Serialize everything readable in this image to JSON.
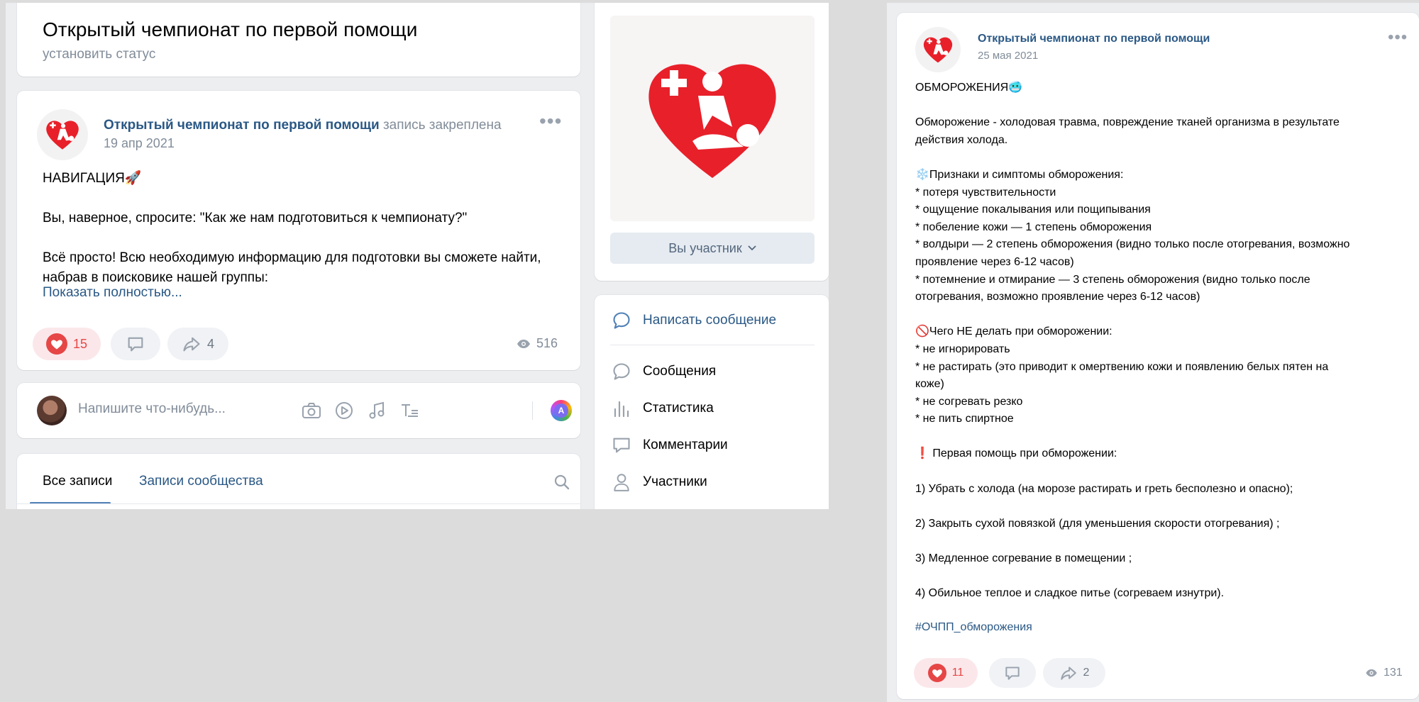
{
  "left": {
    "header": {
      "title": "Открытый чемпионат по первой помощи",
      "status": "установить статус"
    },
    "pinned_post": {
      "author": "Открытый чемпионат по первой помощи",
      "pinned_label": "запись закреплена",
      "date": "19 апр 2021",
      "text_lines": [
        "НАВИГАЦИЯ🚀",
        "",
        "Вы, наверное, спросите: \"Как же нам подготовиться к чемпионату?\"",
        "",
        "Всё просто! Всю необходимую информацию для подготовки вы сможете найти,",
        "набрав в поисковике нашей группы:"
      ],
      "show_more": "Показать полностью...",
      "likes": "15",
      "shares": "4",
      "views": "516"
    },
    "compose": {
      "placeholder": "Напишите что-нибудь...",
      "badge_letter": "A"
    },
    "tabs": {
      "all": "Все записи",
      "community": "Записи сообщества"
    },
    "sidebar": {
      "member_button": "Вы участник",
      "menu": {
        "write": "Написать сообщение",
        "messages": "Сообщения",
        "stats": "Статистика",
        "comments": "Комментарии",
        "members": "Участники"
      }
    }
  },
  "right": {
    "author": "Открытый чемпионат по первой помощи",
    "date": "25 мая 2021",
    "text_lines": [
      "ОБМОРОЖЕНИЯ🥶",
      "",
      "Обморожение - холодовая травма, повреждение тканей организма в результате",
      "действия холода.",
      "",
      "❄️Признаки и симптомы обморожения:",
      "* потеря чувствительности",
      "* ощущение покалывания или пощипывания",
      "* побеление кожи — 1 степень обморожения",
      "* волдыри — 2 степень обморожения (видно только после отогревания, возможно",
      "проявление через 6-12 часов)",
      "* потемнение и отмирание — 3 степень обморожения (видно только после",
      "отогревания, возможно проявление через 6-12 часов)",
      "",
      "🚫Чего НЕ делать при обморожении:",
      "* не игнорировать",
      "* не растирать (это приводит к омертвению кожи и появлению белых пятен на",
      "коже)",
      "* не согревать резко",
      "* не пить спиртное",
      "",
      "❗ Первая помощь при обморожении:",
      "",
      "1) Убрать с холода (на морозе растирать и греть бесполезно и опасно);",
      "",
      "2) Закрыть сухой повязкой (для уменьшения скорости отогревания) ;",
      "",
      "3) Медленное согревание в помещении ;",
      "",
      "4) Обильное теплое и сладкое питье (согреваем изнутри)."
    ],
    "hashtag": "#ОЧПП_обморожения",
    "likes": "11",
    "shares": "2",
    "views": "131"
  },
  "colors": {
    "link": "#2a5885",
    "muted": "#818c99",
    "like_red": "#e64646",
    "logo_red": "#e8202a",
    "page_bg": "#edeef0"
  },
  "icons": [
    "heart-logo",
    "heart-icon",
    "comment-icon",
    "share-icon",
    "eye-icon",
    "camera-icon",
    "video-icon",
    "music-icon",
    "text-icon",
    "search-icon",
    "chat-icon",
    "stats-icon",
    "comments-icon",
    "user-icon",
    "chevron-down-icon",
    "more-icon"
  ]
}
